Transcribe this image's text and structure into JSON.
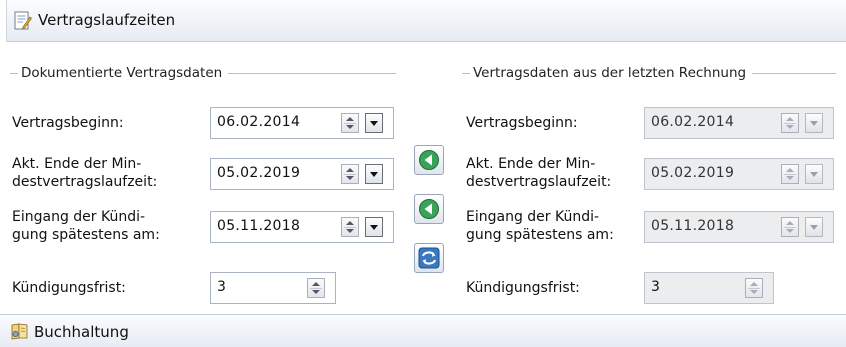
{
  "header": {
    "title": "Vertragslaufzeiten"
  },
  "left_group": {
    "legend": "Dokumentierte Vertragsdaten",
    "fields": {
      "begin": {
        "label": "Vertragsbeginn:",
        "value": "06.02.2014"
      },
      "end": {
        "label_line1": "Akt. Ende der Min-",
        "label_line2": "destvertragslaufzeit:",
        "value": "05.02.2019"
      },
      "notice": {
        "label_line1": "Eingang der Kündi-",
        "label_line2": "gung spätestens am:",
        "value": "05.11.2018"
      },
      "period": {
        "label": "Kündigungsfrist:",
        "value": "3"
      }
    }
  },
  "right_group": {
    "legend": "Vertragsdaten aus der letzten Rechnung",
    "fields": {
      "begin": {
        "label": "Vertragsbeginn:",
        "value": "06.02.2014"
      },
      "end": {
        "label_line1": "Akt. Ende der Min-",
        "label_line2": "destvertragslaufzeit:",
        "value": "05.02.2019"
      },
      "notice": {
        "label_line1": "Eingang der Kündi-",
        "label_line2": "gung spätestens am:",
        "value": "05.11.2018"
      },
      "period": {
        "label": "Kündigungsfrist:",
        "value": "3"
      }
    }
  },
  "actions": {
    "icons": [
      "arrow-left-icon",
      "arrow-left-icon",
      "swap-icon"
    ]
  },
  "footer": {
    "title": "Buchhaltung"
  },
  "colors": {
    "green_button": "#3aa35a",
    "blue_button": "#3a78c2",
    "header_gradient_top": "#fbfcfe",
    "header_gradient_bottom": "#e6ebf3"
  }
}
